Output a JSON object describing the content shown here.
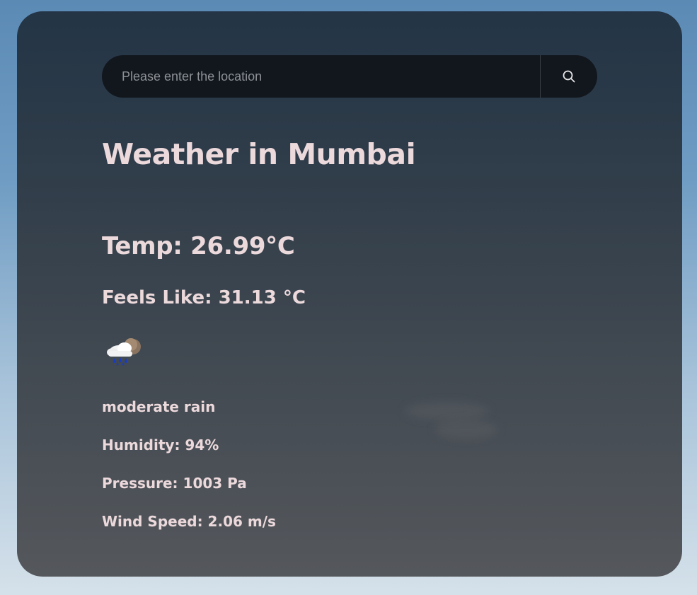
{
  "search": {
    "placeholder": "Please enter the location",
    "value": "",
    "button_icon": "search-icon"
  },
  "weather": {
    "title": "Weather in Mumbai",
    "temp": "Temp: 26.99°C",
    "feels_like": "Feels Like: 31.13 °C",
    "icon": "rain-cloud-moon-icon",
    "description": "moderate rain",
    "humidity": "Humidity: 94%",
    "pressure": "Pressure: 1003 Pa",
    "wind_speed": "Wind Speed: 2.06 m/s"
  },
  "colors": {
    "text": "#ecd9dc",
    "search_bg": "#12171e",
    "card_top": "#213141",
    "card_bottom": "#4e5054"
  }
}
